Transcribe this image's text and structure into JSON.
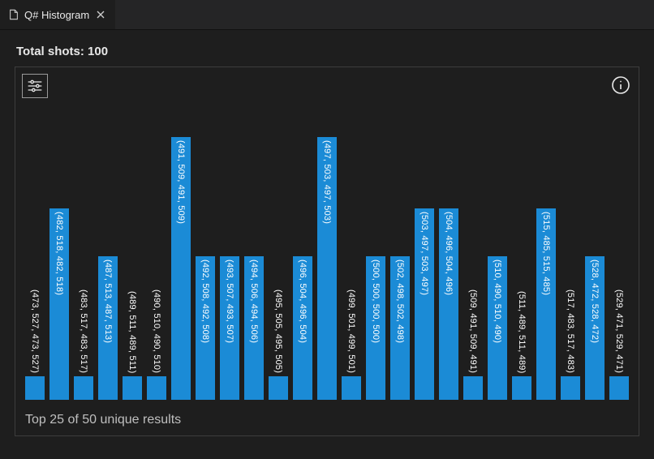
{
  "tab": {
    "title": "Q# Histogram"
  },
  "header": {
    "total_shots_label": "Total shots: 100"
  },
  "footer": {
    "text": "Top 25 of 50 unique results"
  },
  "icons": {
    "file": "file-icon",
    "close": "close-icon",
    "settings": "settings-icon",
    "info": "info-icon"
  },
  "chart_data": {
    "type": "bar",
    "title": "",
    "xlabel": "",
    "ylabel": "",
    "ylim": [
      0,
      12
    ],
    "categories": [
      "(473, 527, 473, 527)",
      "(482, 518, 482, 518)",
      "(483, 517, 483, 517)",
      "(487, 513, 487, 513)",
      "(489, 511, 489, 511)",
      "(490, 510, 490, 510)",
      "(491, 509, 491, 509)",
      "(492, 508, 492, 508)",
      "(493, 507, 493, 507)",
      "(494, 506, 494, 506)",
      "(495, 505, 495, 505)",
      "(496, 504, 496, 504)",
      "(497, 503, 497, 503)",
      "(499, 501, 499, 501)",
      "(500, 500, 500, 500)",
      "(502, 498, 502, 498)",
      "(503, 497, 503, 497)",
      "(504, 496, 504, 496)",
      "(509, 491, 509, 491)",
      "(510, 490, 510, 490)",
      "(511, 489, 511, 489)",
      "(515, 485, 515, 485)",
      "(517, 483, 517, 483)",
      "(528, 472, 528, 472)",
      "(529, 471, 529, 471)"
    ],
    "values": [
      1,
      8,
      1,
      6,
      1,
      1,
      11,
      6,
      6,
      6,
      1,
      6,
      11,
      1,
      6,
      6,
      8,
      8,
      1,
      6,
      1,
      8,
      1,
      6,
      1
    ]
  }
}
